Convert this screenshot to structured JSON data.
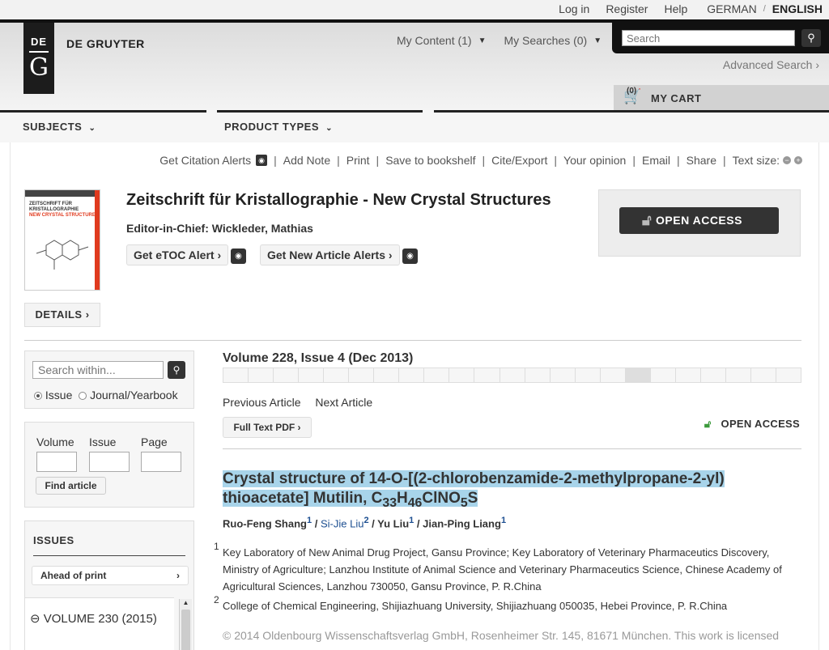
{
  "topbar": {
    "login": "Log in",
    "register": "Register",
    "help": "Help",
    "lang_german": "GERMAN",
    "lang_sep": "/",
    "lang_english": "ENGLISH"
  },
  "header": {
    "logo_top": "DE",
    "logo_bottom": "G",
    "brand": "DE GRUYTER",
    "my_content": "My Content (1)",
    "my_searches": "My Searches (0)",
    "search_placeholder": "Search",
    "advanced_search": "Advanced Search ›",
    "cart_count": "(0)",
    "cart_label": "MY CART"
  },
  "nav": {
    "subjects": "SUBJECTS",
    "product_types": "PRODUCT TYPES"
  },
  "toolbar": {
    "items": [
      "Get Citation Alerts",
      "Add Note",
      "Print",
      "Save to bookshelf",
      "Cite/Export",
      "Your opinion",
      "Email",
      "Share",
      "Text size:"
    ]
  },
  "journal": {
    "cover_title": "ZEITSCHRIFT FÜR KRISTALLOGRAPHIE",
    "cover_sub": "NEW CRYSTAL STRUCTURES",
    "title": "Zeitschrift für Kristallographie - New Crystal Structures",
    "editor": "Editor-in-Chief: Wickleder, Mathias",
    "etoc_btn": "Get eTOC Alert ›",
    "article_alerts_btn": "Get New Article Alerts ›",
    "details_btn": "DETAILS ›",
    "open_access_btn": "OPEN ACCESS"
  },
  "sidebar": {
    "search_placeholder": "Search within...",
    "radio_issue": "Issue",
    "radio_journal": "Journal/Yearbook",
    "volume_label": "Volume",
    "issue_label": "Issue",
    "page_label": "Page",
    "find_article": "Find article",
    "issues_heading": "ISSUES",
    "ahead_of_print": "Ahead of print",
    "volume_2015": "VOLUME 230 (2015)"
  },
  "article": {
    "volume_issue": "Volume 228, Issue 4 (Dec 2013)",
    "prev": "Previous Article",
    "next": "Next Article",
    "pdf_btn": "Full Text PDF ›",
    "open_access": "OPEN ACCESS",
    "title_part1": "Crystal structure of 14-O-[(2-chlorobenzamide-2-methylpropane-2-yl)",
    "title_part2": "thioacetate] Mutilin, C",
    "f_33": "33",
    "f_h": "H",
    "f_46": "46",
    "f_clno": "ClNO",
    "f_5": "5",
    "f_s": "S",
    "author1": "Ruo-Feng Shang",
    "author1_sup": "1",
    "author2": "Si-Jie Liu",
    "author2_sup": "2",
    "author3": "Yu Liu",
    "author3_sup": "1",
    "author4": "Jian-Ping Liang",
    "author4_sup": "1",
    "aff1_num": "1",
    "aff1": "Key Laboratory of New Animal Drug Project, Gansu Province; Key Laboratory of Veterinary Pharmaceutics Discovery, Ministry of Agriculture; Lanzhou Institute of Animal Science and Veterinary Pharmaceutics Science, Chinese Academy of Agricultural Sciences, Lanzhou 730050, Gansu Province, P. R.China",
    "aff2_num": "2",
    "aff2": "College of Chemical Engineering, Shijiazhuang University, Shijiazhuang 050035, Hebei Province, P. R.China",
    "copyright": "© 2014 Oldenbourg Wissenschaftsverlag GmbH, Rosenheimer Str. 145, 81671 München. This work is licensed"
  },
  "colors": {
    "highlight": "#a8d4ea",
    "link": "#1d4f91",
    "open_access_green": "#3c9a3c"
  }
}
